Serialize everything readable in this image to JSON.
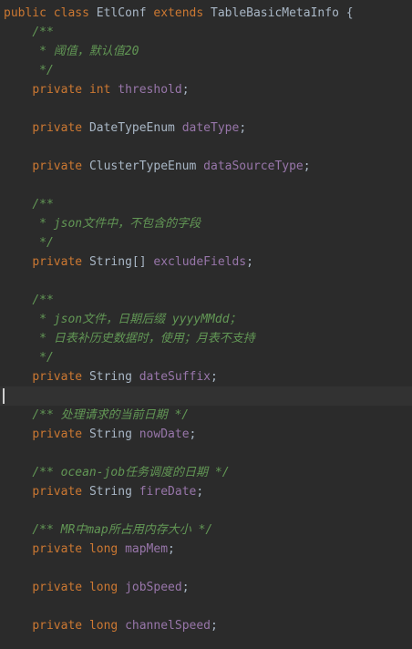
{
  "class_header": {
    "kw_public": "public",
    "kw_class": "class",
    "class_name": "EtlConf",
    "kw_extends": "extends",
    "parent": "TableBasicMetaInfo",
    "brace": "{"
  },
  "lines": [
    {
      "indent": "    ",
      "doc": "/**"
    },
    {
      "indent": "     ",
      "doc": "* 阈值，默认值20"
    },
    {
      "indent": "     ",
      "doc": "*/"
    },
    {
      "indent": "    ",
      "kw": "private",
      "kw2": "int",
      "type": "",
      "field": "threshold",
      "end": ";"
    },
    {
      "blank": true
    },
    {
      "indent": "    ",
      "kw": "private",
      "kw2": "",
      "type": "DateTypeEnum",
      "field": "dateType",
      "end": ";"
    },
    {
      "blank": true
    },
    {
      "indent": "    ",
      "kw": "private",
      "kw2": "",
      "type": "ClusterTypeEnum",
      "field": "dataSourceType",
      "end": ";"
    },
    {
      "blank": true
    },
    {
      "indent": "    ",
      "doc": "/**"
    },
    {
      "indent": "     ",
      "doc": "* json文件中，不包含的字段"
    },
    {
      "indent": "     ",
      "doc": "*/"
    },
    {
      "indent": "    ",
      "kw": "private",
      "kw2": "",
      "type": "String[]",
      "field": "excludeFields",
      "end": ";"
    },
    {
      "blank": true
    },
    {
      "indent": "    ",
      "doc": "/**"
    },
    {
      "indent": "     ",
      "doc": "* json文件，日期后缀 yyyyMMdd；"
    },
    {
      "indent": "     ",
      "doc": "* 日表补历史数据时，使用；月表不支持"
    },
    {
      "indent": "     ",
      "doc": "*/"
    },
    {
      "indent": "    ",
      "kw": "private",
      "kw2": "",
      "type": "String",
      "field": "dateSuffix",
      "end": ";"
    },
    {
      "blank": true,
      "current": true
    },
    {
      "indent": "    ",
      "doc": "/** 处理请求的当前日期 */"
    },
    {
      "indent": "    ",
      "kw": "private",
      "kw2": "",
      "type": "String",
      "field": "nowDate",
      "end": ";"
    },
    {
      "blank": true
    },
    {
      "indent": "    ",
      "doc": "/** ocean-job任务调度的日期 */"
    },
    {
      "indent": "    ",
      "kw": "private",
      "kw2": "",
      "type": "String",
      "field": "fireDate",
      "end": ";"
    },
    {
      "blank": true
    },
    {
      "indent": "    ",
      "doc": "/** MR中map所占用内存大小 */"
    },
    {
      "indent": "    ",
      "kw": "private",
      "kw2": "long",
      "type": "",
      "field": "mapMem",
      "end": ";"
    },
    {
      "blank": true
    },
    {
      "indent": "    ",
      "kw": "private",
      "kw2": "long",
      "type": "",
      "field": "jobSpeed",
      "end": ";"
    },
    {
      "blank": true
    },
    {
      "indent": "    ",
      "kw": "private",
      "kw2": "long",
      "type": "",
      "field": "channelSpeed",
      "end": ";"
    }
  ],
  "colors": {
    "background": "#2b2b2b",
    "keyword": "#cc7832",
    "field": "#9876aa",
    "doc_comment": "#629755",
    "plain": "#a9b7c6",
    "current_line": "#323232"
  }
}
